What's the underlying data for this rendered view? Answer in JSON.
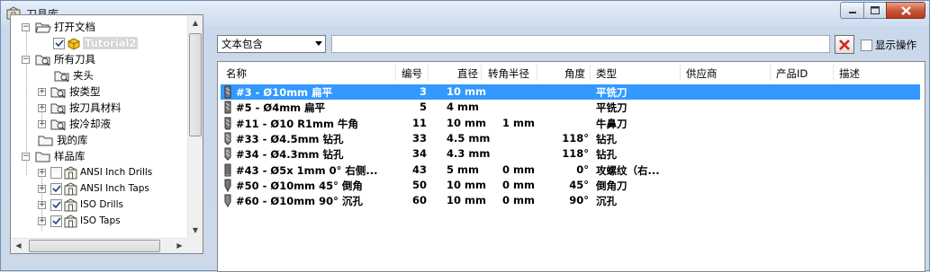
{
  "window": {
    "title": "刀具库",
    "icon": "library-icon"
  },
  "filter": {
    "mode_value": "文本包含",
    "input_value": "",
    "clear_icon": "clear-x-icon",
    "show_ops_label": "显示操作",
    "show_ops_checked": false
  },
  "tree": {
    "nodes": [
      {
        "label": "打开文档",
        "icon": "folder-open-icon"
      },
      {
        "label": "Tutorial2",
        "icon": "part-icon",
        "checked": true,
        "selected": true
      },
      {
        "label": "所有刀具",
        "icon": "tool-folder-icon"
      },
      {
        "label": "夹头",
        "icon": "tool-folder-icon"
      },
      {
        "label": "按类型",
        "icon": "tool-folder-icon"
      },
      {
        "label": "按刀具材料",
        "icon": "tool-folder-icon"
      },
      {
        "label": "按冷却液",
        "icon": "tool-folder-icon"
      },
      {
        "label": "我的库",
        "icon": "folder-icon"
      },
      {
        "label": "样品库",
        "icon": "folder-icon"
      },
      {
        "label": "ANSI Inch Drills",
        "icon": "library-icon",
        "checked": false
      },
      {
        "label": "ANSI Inch Taps",
        "icon": "library-icon",
        "checked": true
      },
      {
        "label": "ISO Drills",
        "icon": "library-icon",
        "checked": true
      },
      {
        "label": "ISO Taps",
        "icon": "library-icon",
        "checked": true
      }
    ]
  },
  "table": {
    "columns": [
      "名称",
      "编号",
      "直径",
      "转角半径",
      "角度",
      "类型",
      "供应商",
      "产品ID",
      "描述"
    ],
    "rows": [
      {
        "name": "#3 - Ø10mm 扁平",
        "num": "3",
        "dia": "10 mm",
        "radius": "",
        "angle": "",
        "type": "平铣刀",
        "icon": "flat-endmill-icon",
        "selected": true
      },
      {
        "name": "#5 - Ø4mm 扁平",
        "num": "5",
        "dia": "4 mm",
        "radius": "",
        "angle": "",
        "type": "平铣刀",
        "icon": "flat-endmill-icon"
      },
      {
        "name": "#11 - Ø10 R1mm 牛角",
        "num": "11",
        "dia": "10 mm",
        "radius": "1 mm",
        "angle": "",
        "type": "牛鼻刀",
        "icon": "bull-endmill-icon"
      },
      {
        "name": "#33 - Ø4.5mm 钻孔",
        "num": "33",
        "dia": "4.5 mm",
        "radius": "",
        "angle": "118°",
        "type": "钻孔",
        "icon": "drill-icon"
      },
      {
        "name": "#34 - Ø4.3mm 钻孔",
        "num": "34",
        "dia": "4.3 mm",
        "radius": "",
        "angle": "118°",
        "type": "钻孔",
        "icon": "drill-icon"
      },
      {
        "name": "#43 - Ø5x 1mm 0° 右侧...",
        "num": "43",
        "dia": "5 mm",
        "radius": "0 mm",
        "angle": "0°",
        "type": "攻螺纹（右...",
        "icon": "tap-icon"
      },
      {
        "name": "#50 - Ø10mm 45° 倒角",
        "num": "50",
        "dia": "10 mm",
        "radius": "0 mm",
        "angle": "45°",
        "type": "倒角刀",
        "icon": "chamfer-icon"
      },
      {
        "name": "#60 - Ø10mm 90° 沉孔",
        "num": "60",
        "dia": "10 mm",
        "radius": "0 mm",
        "angle": "90°",
        "type": "沉孔",
        "icon": "countersink-icon"
      }
    ]
  },
  "colors": {
    "selection": "#3399ff",
    "close_button": "#c85a3b"
  }
}
